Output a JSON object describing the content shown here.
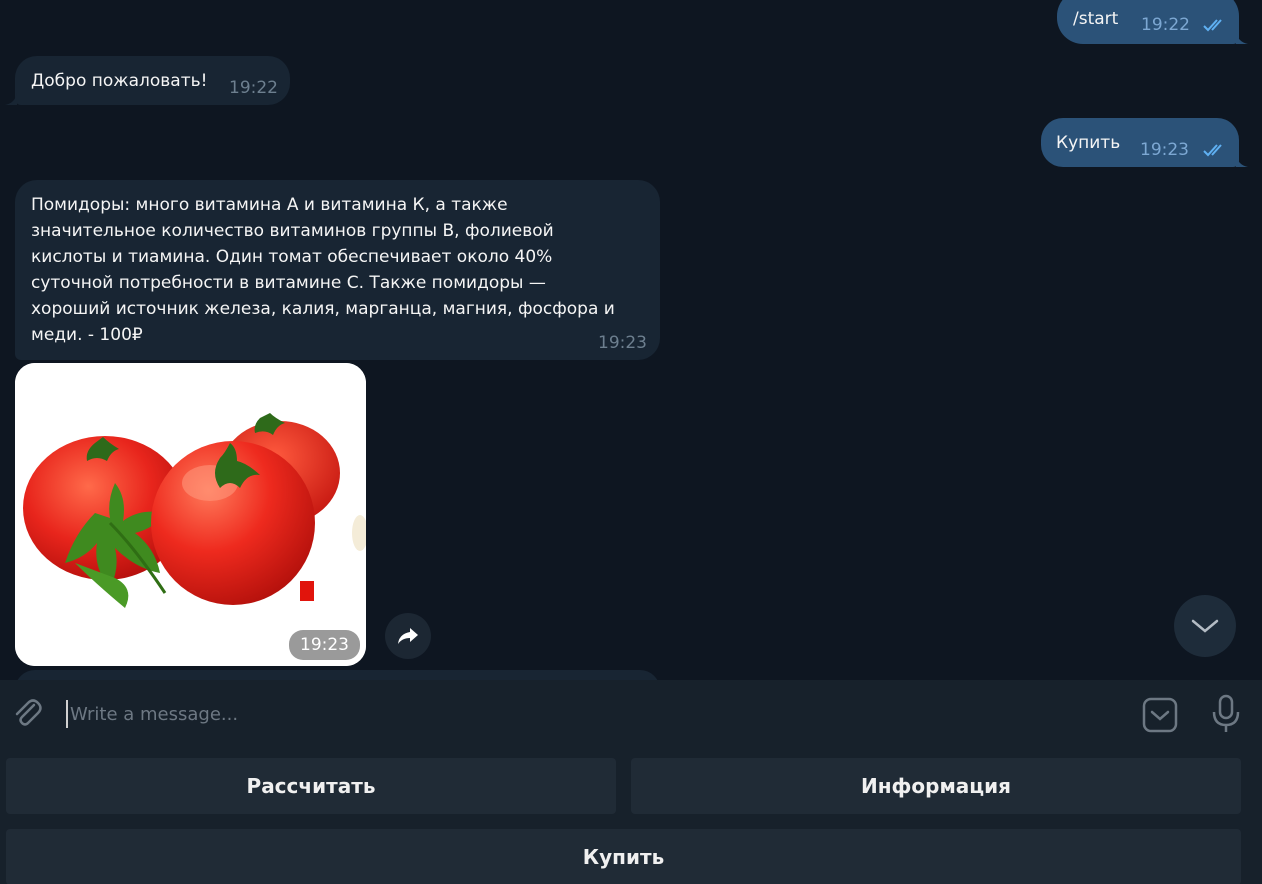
{
  "messages": {
    "start": {
      "text": "/start",
      "time": "19:22",
      "direction": "outgoing"
    },
    "welcome": {
      "text": "Добро пожаловать!",
      "time": "19:22",
      "direction": "incoming"
    },
    "buy": {
      "text": "Купить",
      "time": "19:23",
      "direction": "outgoing"
    },
    "description": {
      "text": "Помидоры: много витамина А и витамина К, а также\nзначительное количество витаминов группы B, фолиевой\nкислоты и тиамина. Один томат обеспечивает около 40%\nсуточной потребности в витамине С. Также помидоры —\nхороший источник железа, калия, марганца, магния, фосфора и\nмеди. - 100₽",
      "time": "19:23",
      "direction": "incoming"
    },
    "photo": {
      "time": "19:23",
      "subject": "tomatoes-photo"
    }
  },
  "composer": {
    "placeholder": "Write a message...",
    "attach_icon": "paperclip-icon",
    "emoji_icon": "sticker-icon",
    "voice_icon": "microphone-icon"
  },
  "keyboard": {
    "row1": [
      "Рассчитать",
      "Информация"
    ],
    "row2": [
      "Купить"
    ]
  },
  "colors": {
    "background": "#0e1621",
    "incoming_bubble": "#182533",
    "outgoing_bubble": "#2b5278",
    "panel": "#17212b",
    "keyboard_button": "#202b36",
    "read_ticks": "#5fb0f2"
  }
}
